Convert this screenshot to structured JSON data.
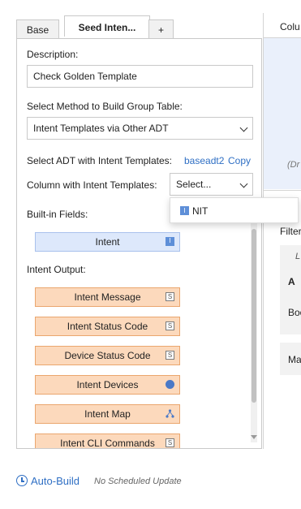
{
  "tabs": [
    {
      "label": "Base"
    },
    {
      "label": "Seed Inten..."
    },
    {
      "label": "+"
    }
  ],
  "form": {
    "description_label": "Description:",
    "description_value": "Check Golden Template",
    "method_label": "Select Method to Build Group Table:",
    "method_value": "Intent Templates via Other ADT",
    "adt_label": "Select ADT with Intent Templates:",
    "adt_link": "baseadt2",
    "adt_copy": "Copy",
    "column_label": "Column with Intent Templates:",
    "column_placeholder": "Select...",
    "builtin_label": "Built-in Fields:",
    "output_label": "Intent Output:"
  },
  "builtin_fields": [
    {
      "label": "Intent",
      "icon": "intent-icon"
    }
  ],
  "output_fields": [
    {
      "label": "Intent Message",
      "icon": "string-icon"
    },
    {
      "label": "Intent Status Code",
      "icon": "string-icon"
    },
    {
      "label": "Device Status Code",
      "icon": "string-icon"
    },
    {
      "label": "Intent Devices",
      "icon": "devices-icon"
    },
    {
      "label": "Intent Map",
      "icon": "map-icon"
    },
    {
      "label": "Intent CLI Commands",
      "icon": "string-icon"
    }
  ],
  "dropdown": {
    "options": [
      {
        "label": "NIT",
        "icon": "intent-icon"
      }
    ]
  },
  "right_panel": {
    "column_header": "Colu",
    "drop_hint": "(Dr",
    "filter": "Filter",
    "row_letter": "L",
    "col_a": "A",
    "boo": "Boo",
    "ma": "Ma"
  },
  "footer": {
    "auto_build": "Auto-Build",
    "schedule": "No Scheduled Update"
  },
  "colors": {
    "builtin_bg": "#dde8fb",
    "output_bg": "#fcd9bc",
    "link": "#2f6fc4"
  }
}
